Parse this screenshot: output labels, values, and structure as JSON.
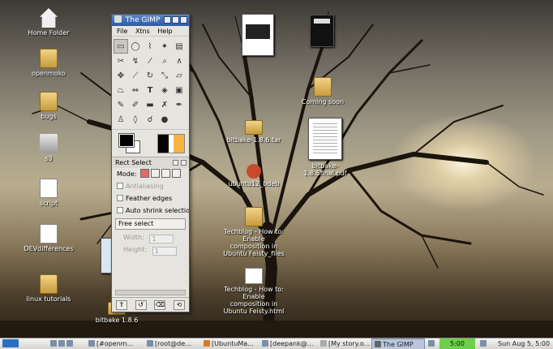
{
  "desktop_icons": [
    {
      "label": "Home Folder",
      "icon": "home-icon"
    },
    {
      "label": "openmoko",
      "icon": "folder-icon"
    },
    {
      "label": "bugs",
      "icon": "folder-icon"
    },
    {
      "label": "s3",
      "icon": "drive-icon"
    },
    {
      "label": "script",
      "icon": "document-icon"
    },
    {
      "label": "DEVdifferences",
      "icon": "document-icon"
    },
    {
      "label": "linux tutorials",
      "icon": "folder-icon"
    },
    {
      "label": "bitbake 1.8.6",
      "icon": "folder-icon"
    },
    {
      "label": "Techblog - How to: Enable composition in Ubuntu Feisty_files",
      "icon": "folder-icon"
    },
    {
      "label": "Techblog - How to: Enable composition in Ubuntu Feisty.html",
      "icon": "document-icon"
    },
    {
      "label": "bitbake-1.8.6.tar",
      "icon": "folder-icon"
    },
    {
      "label": "ubuntu12_bdeb",
      "icon": "debian-icon"
    },
    {
      "label": "Coming soon",
      "icon": "folder-icon"
    },
    {
      "label": "bitbake-1.8.5final.pdf",
      "icon": "pdf-icon"
    }
  ],
  "gimp": {
    "title": "The GIMP",
    "menu": [
      "File",
      "Xtns",
      "Help"
    ],
    "tool_options_title": "Rect Select",
    "mode_label": "Mode:",
    "antialiasing": "Antialiasing",
    "feather_edges": "Feather edges",
    "auto_shrink": "Auto shrink selectio",
    "free_select": "Free select",
    "width_label": "Width:",
    "height_label": "Height:",
    "width_value": "1",
    "height_value": "1"
  },
  "taskbar": {
    "tasks": [
      "[#openm...",
      "[root@de...",
      "[UbuntuMa...",
      "[deepank@...",
      "[My story.o...",
      "The GIMP"
    ],
    "active_task": "The GIMP",
    "time_box": "5:00",
    "clock": "Sun Aug  5,  5:00"
  },
  "colors": {
    "accent": "#2f5aa6",
    "time_bg": "#6ecf4a"
  }
}
